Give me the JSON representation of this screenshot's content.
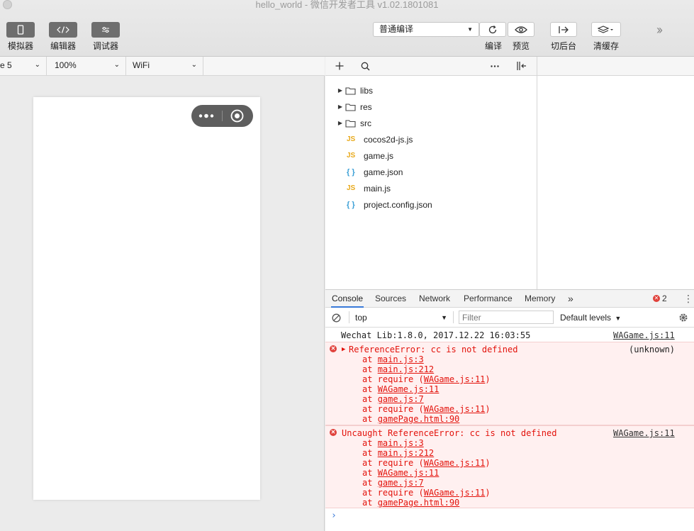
{
  "window": {
    "title": "hello_world - 微信开发者工具 v1.02.1801081"
  },
  "toolbar": {
    "simulator_label": "模拟器",
    "editor_label": "编辑器",
    "debugger_label": "调试器",
    "compile_mode": "普通编译",
    "compile_label": "编译",
    "preview_label": "预览",
    "background_label": "切后台",
    "clear_cache_label": "清缓存"
  },
  "simulator": {
    "device": "e 5",
    "zoom": "100%",
    "network": "WiFi"
  },
  "file_tree": {
    "items": [
      {
        "name": "libs",
        "type": "folder"
      },
      {
        "name": "res",
        "type": "folder"
      },
      {
        "name": "src",
        "type": "folder"
      },
      {
        "name": "cocos2d-js.js",
        "type": "js",
        "badge": "JS"
      },
      {
        "name": "game.js",
        "type": "js",
        "badge": "JS"
      },
      {
        "name": "game.json",
        "type": "json",
        "badge": "{ }"
      },
      {
        "name": "main.js",
        "type": "js",
        "badge": "JS"
      },
      {
        "name": "project.config.json",
        "type": "json",
        "badge": "{ }"
      }
    ]
  },
  "devtools": {
    "tabs": [
      "Console",
      "Sources",
      "Network",
      "Performance",
      "Memory"
    ],
    "active_tab": "Console",
    "error_count": "2",
    "context": "top",
    "filter_placeholder": "Filter",
    "levels": "Default levels"
  },
  "console": {
    "info": {
      "text": "Wechat Lib:1.8.0, 2017.12.22 16:03:55",
      "source": "WAGame.js:11"
    },
    "error1": {
      "message": "ReferenceError: cc is not defined",
      "source": "(unknown)",
      "stack": [
        {
          "prefix": "at ",
          "link": "main.js:3",
          "suffix": ""
        },
        {
          "prefix": "at ",
          "link": "main.js:212",
          "suffix": ""
        },
        {
          "prefix": "at require (",
          "link": "WAGame.js:11",
          "suffix": ")"
        },
        {
          "prefix": "at ",
          "link": "WAGame.js:11",
          "suffix": ""
        },
        {
          "prefix": "at ",
          "link": "game.js:7",
          "suffix": ""
        },
        {
          "prefix": "at require (",
          "link": "WAGame.js:11",
          "suffix": ")"
        },
        {
          "prefix": "at ",
          "link": "gamePage.html:90",
          "suffix": ""
        }
      ]
    },
    "error2": {
      "message": "Uncaught ReferenceError: cc is not defined",
      "source": "WAGame.js:11",
      "stack": [
        {
          "prefix": "at ",
          "link": "main.js:3",
          "suffix": ""
        },
        {
          "prefix": "at ",
          "link": "main.js:212",
          "suffix": ""
        },
        {
          "prefix": "at require (",
          "link": "WAGame.js:11",
          "suffix": ")"
        },
        {
          "prefix": "at ",
          "link": "WAGame.js:11",
          "suffix": ""
        },
        {
          "prefix": "at ",
          "link": "game.js:7",
          "suffix": ""
        },
        {
          "prefix": "at require (",
          "link": "WAGame.js:11",
          "suffix": ")"
        },
        {
          "prefix": "at ",
          "link": "gamePage.html:90",
          "suffix": ""
        }
      ]
    },
    "prompt": "›"
  }
}
